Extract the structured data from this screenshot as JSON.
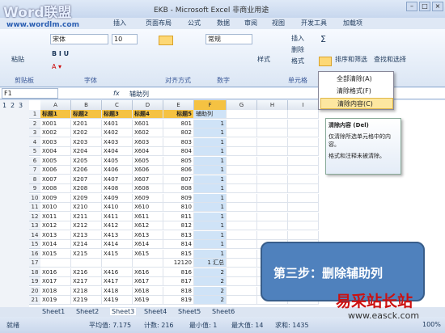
{
  "window": {
    "title": "EKB - Microsoft Excel 非商业用途",
    "logo": "Word联盟",
    "logo_url": "www.wordlm.com",
    "min": "–",
    "max": "□",
    "close": "×"
  },
  "tabs": [
    "插入",
    "页面布局",
    "公式",
    "数据",
    "审阅",
    "视图",
    "开发工具",
    "加载项"
  ],
  "ribbon": {
    "paste": "粘贴",
    "font_name": "宋体",
    "font_size": "10",
    "number_format": "常规",
    "style": "样式",
    "insert": "插入",
    "delete": "删除",
    "format": "格式",
    "sort": "排序和筛选",
    "find": "查找和选择",
    "groups": [
      "剪贴板",
      "字体",
      "对齐方式",
      "数字",
      "单元格"
    ]
  },
  "formula": {
    "namebox": "F1",
    "fx": "fx",
    "content": "辅助列"
  },
  "menu": {
    "items": [
      "全部清除(A)",
      "清除格式(F)",
      "清除内容(C)"
    ]
  },
  "tooltip": {
    "title": "清除内容 (Del)",
    "line1": "仅清除所选单元格中的内容。",
    "line2": "格式和注释未被清除。"
  },
  "columns": [
    "A",
    "B",
    "C",
    "D",
    "E",
    "F",
    "G",
    "H",
    "I"
  ],
  "outline_levels": [
    "1",
    "2",
    "3"
  ],
  "rows": [
    {
      "n": "1",
      "c": [
        "标题1",
        "标题2",
        "标题3",
        "标题4",
        "标题5",
        "辅助列"
      ]
    },
    {
      "n": "2",
      "c": [
        "X001",
        "X201",
        "X401",
        "X601",
        "801",
        "1"
      ]
    },
    {
      "n": "3",
      "c": [
        "X002",
        "X202",
        "X402",
        "X602",
        "802",
        "1"
      ]
    },
    {
      "n": "4",
      "c": [
        "X003",
        "X203",
        "X403",
        "X603",
        "803",
        "1"
      ]
    },
    {
      "n": "5",
      "c": [
        "X004",
        "X204",
        "X404",
        "X604",
        "804",
        "1"
      ]
    },
    {
      "n": "6",
      "c": [
        "X005",
        "X205",
        "X405",
        "X605",
        "805",
        "1"
      ]
    },
    {
      "n": "7",
      "c": [
        "X006",
        "X206",
        "X406",
        "X606",
        "806",
        "1"
      ]
    },
    {
      "n": "8",
      "c": [
        "X007",
        "X207",
        "X407",
        "X607",
        "807",
        "1"
      ]
    },
    {
      "n": "9",
      "c": [
        "X008",
        "X208",
        "X408",
        "X608",
        "808",
        "1"
      ]
    },
    {
      "n": "10",
      "c": [
        "X009",
        "X209",
        "X409",
        "X609",
        "809",
        "1"
      ]
    },
    {
      "n": "11",
      "c": [
        "X010",
        "X210",
        "X410",
        "X610",
        "810",
        "1"
      ]
    },
    {
      "n": "12",
      "c": [
        "X011",
        "X211",
        "X411",
        "X611",
        "811",
        "1"
      ]
    },
    {
      "n": "13",
      "c": [
        "X012",
        "X212",
        "X412",
        "X612",
        "812",
        "1"
      ]
    },
    {
      "n": "14",
      "c": [
        "X013",
        "X213",
        "X413",
        "X613",
        "813",
        "1"
      ]
    },
    {
      "n": "15",
      "c": [
        "X014",
        "X214",
        "X414",
        "X614",
        "814",
        "1"
      ]
    },
    {
      "n": "16",
      "c": [
        "X015",
        "X215",
        "X415",
        "X615",
        "815",
        "1"
      ]
    },
    {
      "n": "17",
      "c": [
        "",
        "",
        "",
        "",
        "12120",
        "1 汇总"
      ]
    },
    {
      "n": "18",
      "c": [
        "X016",
        "X216",
        "X416",
        "X616",
        "816",
        "2"
      ]
    },
    {
      "n": "19",
      "c": [
        "X017",
        "X217",
        "X417",
        "X617",
        "817",
        "2"
      ]
    },
    {
      "n": "20",
      "c": [
        "X018",
        "X218",
        "X418",
        "X618",
        "818",
        "2"
      ]
    },
    {
      "n": "21",
      "c": [
        "X019",
        "X219",
        "X419",
        "X619",
        "819",
        "2"
      ]
    }
  ],
  "sheets": [
    "Sheet1",
    "Sheet2",
    "Sheet3",
    "Sheet4",
    "Sheet5",
    "Sheet6"
  ],
  "status": {
    "mode": "就绪",
    "avg": "平均值: 7.175",
    "count": "计数: 216",
    "sum": "求和: 1435",
    "min": "最小值: 1",
    "max": "最大值: 14",
    "zoom": "100%"
  },
  "callout": "第三步：删除辅助列",
  "watermark": "易采站长站",
  "watermark_url": "www.easck.com"
}
